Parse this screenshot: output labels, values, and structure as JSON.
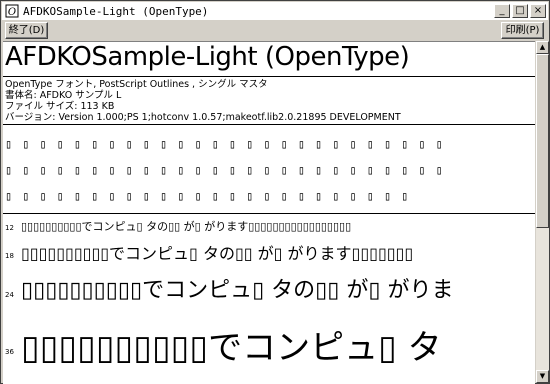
{
  "window": {
    "title": "AFDKOSample-Light (OpenType)",
    "minimize_glyph": "_",
    "maximize_glyph": "□",
    "close_glyph": "×"
  },
  "toolbar": {
    "close_label": "終了(D)",
    "print_label": "印刷(P)"
  },
  "content": {
    "font_title": "AFDKOSample-Light (OpenType)",
    "info": [
      "OpenType フォント, PostScript Outlines , シングル マスタ",
      "書体名: AFDKO サンプル L",
      "ファイル サイズ: 113 KB",
      "バージョン: Version 1.000;PS 1;hotconv 1.0.57;makeotf.lib2.0.21895 DEVELOPMENT"
    ],
    "char_rows": [
      "▯▯▯▯▯▯▯▯▯▯▯▯▯▯▯▯▯▯▯▯▯▯▯▯▯▯",
      "▯▯▯▯▯▯▯▯▯▯▯▯▯▯▯▯▯▯▯▯▯▯▯▯▯▯",
      "▯▯▯▯▯▯▯▯▯▯▯▯▯▯▯▯▯▯▯▯▯▯▯▯"
    ],
    "samples": [
      {
        "size": "12",
        "text": "▯▯▯▯▯▯▯▯▯▯でコンピュ▯ タの▯▯ が▯ がります▯▯▯▯▯▯▯▯▯▯▯▯▯▯▯▯▯"
      },
      {
        "size": "18",
        "text": "▯▯▯▯▯▯▯▯▯▯でコンピュ▯ タの▯▯ が▯ がります▯▯▯▯▯▯▯"
      },
      {
        "size": "24",
        "text": "▯▯▯▯▯▯▯▯▯▯でコンピュ▯ タの▯▯ が▯ がりま"
      },
      {
        "size": "36",
        "text": "▯▯▯▯▯▯▯▯▯▯でコンピュ▯ タ"
      }
    ]
  },
  "scrollbar": {
    "up_glyph": "▲",
    "down_glyph": "▼"
  }
}
